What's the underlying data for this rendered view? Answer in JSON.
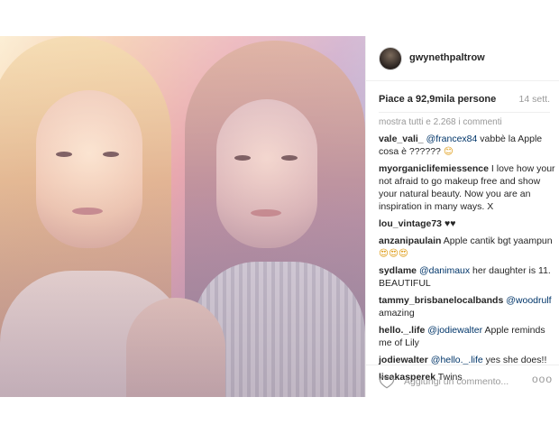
{
  "post": {
    "username": "gwynethpaltrow",
    "likes": "Piace a 92,9mila persone",
    "time": "14 sett.",
    "show_all": "mostra tutti e 2.268 i commenti",
    "add_comment_placeholder": "Aggiungi un commento...",
    "more_label": "ooo",
    "comments": [
      {
        "user": "vale_vali_",
        "mention": "@francex84",
        "text": " vabbè la Apple cosa è ?????? ",
        "emoji": "😊"
      },
      {
        "user": "myorganiclifemiessence",
        "mention": "",
        "text": " I love how your not afraid to go makeup free and show your natural beauty. Now you are an inspiration in many ways. X",
        "emoji": ""
      },
      {
        "user": "lou_vintage73",
        "mention": "",
        "text": " ♥♥",
        "emoji": ""
      },
      {
        "user": "anzanipaulain",
        "mention": "",
        "text": " Apple cantik bgt yaampun ",
        "emoji": "😍😍😍"
      },
      {
        "user": "sydlame",
        "mention": "@danimaux",
        "text": " her daughter is 11. BEAUTIFUL",
        "emoji": ""
      },
      {
        "user": "tammy_brisbanelocalbands",
        "mention": "@woodrulf",
        "text": " amazing",
        "emoji": ""
      },
      {
        "user": "hello._.life",
        "mention": "@jodiewalter",
        "text": " Apple reminds me of Lily",
        "emoji": ""
      },
      {
        "user": "jodiewalter",
        "mention": "@hello._.life",
        "text": " yes she does!!",
        "emoji": ""
      },
      {
        "user": "lisakasperek",
        "mention": "",
        "text": " Twins",
        "emoji": ""
      }
    ]
  }
}
